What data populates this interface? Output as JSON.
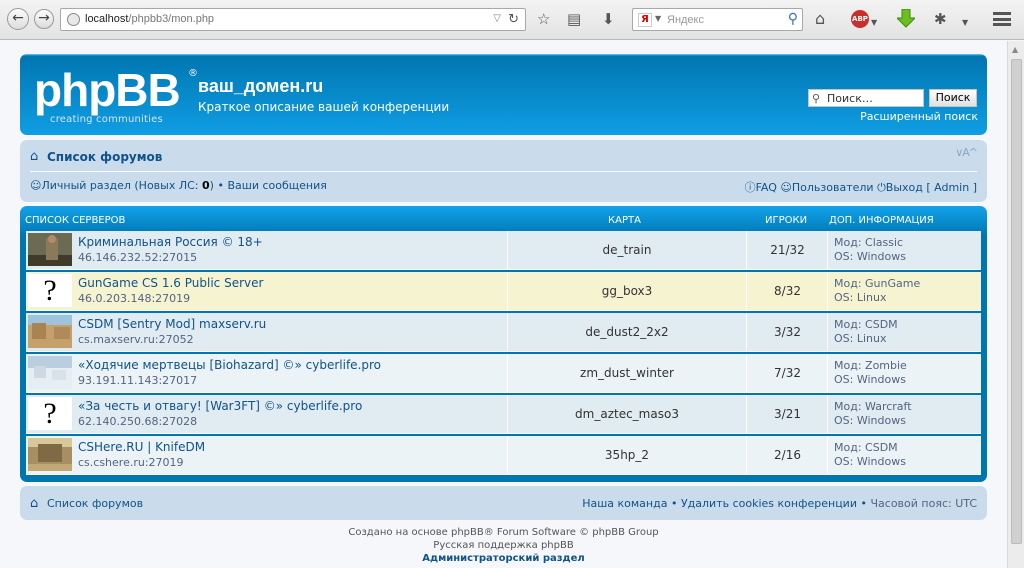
{
  "browser": {
    "url_host": "localhost",
    "url_path": "/phpbb3/mon.php",
    "search_placeholder": "Яндекс",
    "search_engine_letter": "Я",
    "abp_label": "ABP"
  },
  "header": {
    "logo_text": "phpBB",
    "logo_reg": "®",
    "logo_sub_1": "creating",
    "logo_sub_2": "communities",
    "site_title": "ваш_домен.ru",
    "site_description": "Краткое описание вашей конференции",
    "search_placeholder": "Поиск…",
    "search_button": "Поиск",
    "advanced_search": "Расширенный поиск"
  },
  "navbar": {
    "breadcrumb": "Список форумов",
    "font_size_toggle": "∨A^",
    "ucp_label": "Личный раздел (Новых ЛС: ",
    "ucp_count": "0",
    "ucp_suffix": ")",
    "separator": "•",
    "messages": "Ваши сообщения",
    "faq": "FAQ",
    "members": "Пользователи",
    "logout": "Выход",
    "logout_user": "[ Admin ]"
  },
  "table": {
    "headers": [
      "СПИСОК СЕРВЕРОВ",
      "КАРТА",
      "ИГРОКИ",
      "ДОП. ИНФОРМАЦИЯ"
    ],
    "rows": [
      {
        "name": "Криминальная Россия © 18+",
        "ip": "46.146.232.52:27015",
        "map": "de_train",
        "players": "21/32",
        "mod": "Мод: Classic",
        "os": "OS: Windows"
      },
      {
        "name": "GunGame CS 1.6 Public Server",
        "ip": "46.0.203.148:27019",
        "map": "gg_box3",
        "players": "8/32",
        "mod": "Мод: GunGame",
        "os": "OS: Linux"
      },
      {
        "name": "CSDM [Sentry Mod] maxserv.ru",
        "ip": "cs.maxserv.ru:27052",
        "map": "de_dust2_2x2",
        "players": "3/32",
        "mod": "Мод: CSDM",
        "os": "OS: Linux"
      },
      {
        "name": "«Ходячие мертвецы [Biohazard] ©» cyberlife.pro",
        "ip": "93.191.11.143:27017",
        "map": "zm_dust_winter",
        "players": "7/32",
        "mod": "Мод: Zombie",
        "os": "OS: Windows"
      },
      {
        "name": "«За честь и отвагу! [War3FT] ©» cyberlife.pro",
        "ip": "62.140.250.68:27028",
        "map": "dm_aztec_maso3",
        "players": "3/21",
        "mod": "Мод: Warcraft",
        "os": "OS: Windows"
      },
      {
        "name": "CSHere.RU | KnifeDM",
        "ip": "cs.cshere.ru:27019",
        "map": "35hp_2",
        "players": "2/16",
        "mod": "Мод: CSDM",
        "os": "OS: Windows"
      }
    ]
  },
  "footer": {
    "breadcrumb": "Список форумов",
    "team": "Наша команда",
    "delete_cookies": "Удалить cookies конференции",
    "timezone": "Часовой пояс: UTC",
    "separator": "•",
    "copyright_1": "Создано на основе phpBB® Forum Software © phpBB Group",
    "copyright_2": "Русская поддержка phpBB",
    "admin_link": "Администраторский раздел"
  },
  "colors": {
    "header_blue": "#12a3eb",
    "link_blue": "#105289",
    "nav_bg": "#cadceb",
    "highlight_row": "#f6f4d0"
  },
  "icons": [
    "back-icon",
    "forward-icon",
    "globe-icon",
    "reload-icon",
    "star-icon",
    "clipboard-icon",
    "download-icon",
    "home-icon",
    "abp-icon",
    "green-download-icon",
    "bug-icon",
    "menu-icon",
    "search-icon",
    "faq-icon",
    "members-icon",
    "logout-icon",
    "user-icon"
  ]
}
